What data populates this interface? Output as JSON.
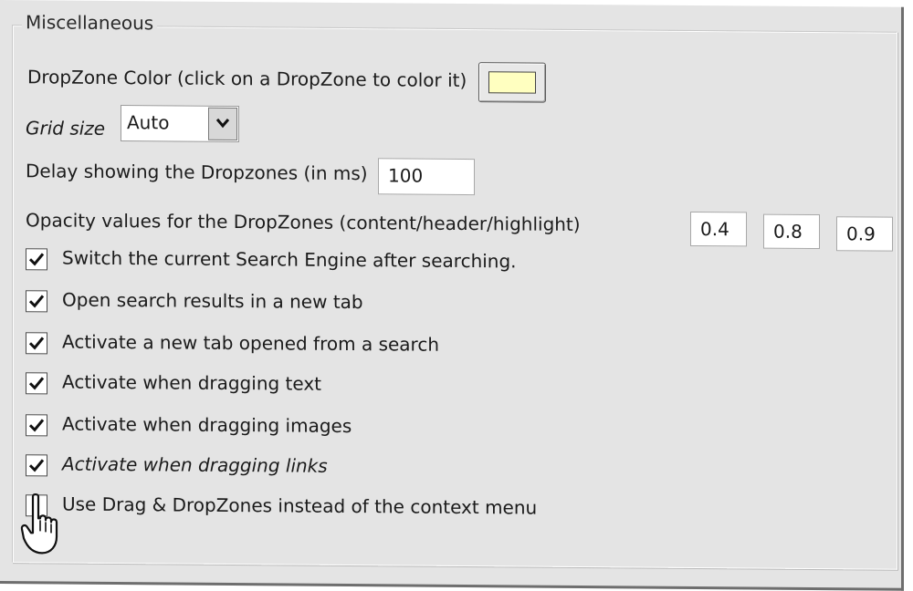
{
  "group": {
    "title": "Miscellaneous"
  },
  "dropzone_color": {
    "label": "DropZone Color (click on a DropZone to color it)",
    "swatch_color": "#ffffc0"
  },
  "grid_size": {
    "label": "Grid size",
    "value": "Auto"
  },
  "delay": {
    "label": "Delay showing the Dropzones (in ms)",
    "value": "100"
  },
  "opacity": {
    "label": "Opacity values for the DropZones (content/header/highlight)",
    "content": "0.4",
    "header": "0.8",
    "highlight": "0.9"
  },
  "options": [
    {
      "label": "Switch the current Search Engine after searching.",
      "checked": true
    },
    {
      "label": "Open search results in a new tab",
      "checked": true
    },
    {
      "label": "Activate a new tab opened from a search",
      "checked": true
    },
    {
      "label": "Activate when dragging text",
      "checked": true
    },
    {
      "label": "Activate when dragging images",
      "checked": true
    },
    {
      "label": "Activate when dragging links",
      "checked": true
    },
    {
      "label": "Use Drag & DropZones instead of the context menu",
      "checked": false
    }
  ],
  "icons": {
    "checkmark": "checkmark-icon",
    "dropdown": "chevron-down-icon",
    "cursor": "hand-pointer-icon"
  }
}
